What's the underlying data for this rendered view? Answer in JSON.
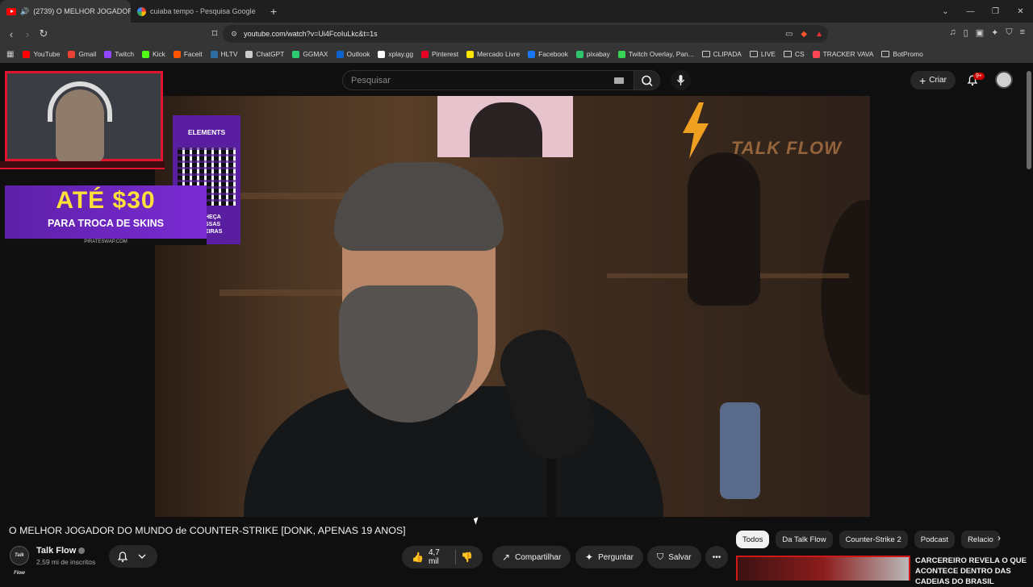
{
  "browser": {
    "tabs": [
      {
        "title": "(2739) O MELHOR JOGADOR",
        "active": true
      },
      {
        "title": "cuiaba tempo - Pesquisa Google",
        "active": false
      }
    ],
    "new_tab": "+",
    "url": "youtube.com/watch?v=Ui4FcoIuLkc&t=1s",
    "bookmarks": [
      {
        "label": "YouTube",
        "color": "#ff0000"
      },
      {
        "label": "Gmail",
        "color": "#ea4335"
      },
      {
        "label": "Twitch",
        "color": "#9146ff"
      },
      {
        "label": "Kick",
        "color": "#53fc18"
      },
      {
        "label": "Faceit",
        "color": "#ff5500"
      },
      {
        "label": "HLTV",
        "color": "#2d6da3"
      },
      {
        "label": "ChatGPT",
        "color": "#cccccc"
      },
      {
        "label": "GGMAX",
        "color": "#2ecc71"
      },
      {
        "label": "Outlook",
        "color": "#0a64d0"
      },
      {
        "label": "xplay.gg",
        "color": "#ffffff"
      },
      {
        "label": "Pinterest",
        "color": "#e60023"
      },
      {
        "label": "Mercado Livre",
        "color": "#ffe600"
      },
      {
        "label": "Facebook",
        "color": "#1877f2"
      },
      {
        "label": "pixabay",
        "color": "#2ec66d"
      },
      {
        "label": "Twitch Overlay, Pan...",
        "color": "#39d353"
      },
      {
        "label": "CLIPADA",
        "folder": true
      },
      {
        "label": "LIVE",
        "folder": true
      },
      {
        "label": "CS",
        "folder": true
      },
      {
        "label": "TRACKER VAVA",
        "color": "#ff4655"
      },
      {
        "label": "BotPromo",
        "folder": true
      }
    ]
  },
  "youtube": {
    "search_placeholder": "Pesquisar",
    "create_label": "Criar",
    "notifications_badge": "9+",
    "video_title": "O MELHOR JOGADOR DO MUNDO de COUNTER-STRIKE [DONK, APENAS 19 ANOS]",
    "channel": {
      "name": "Talk Flow",
      "subscribers": "2,59 mi de inscritos",
      "avatar_text": "Talk Flow"
    },
    "watermark": "TALK FLOW",
    "actions": {
      "likes": "4,7 mil",
      "share": "Compartilhar",
      "ask": "Perguntar",
      "save": "Salvar"
    },
    "chips": [
      "Todos",
      "Da Talk Flow",
      "Counter-Strike 2",
      "Podcast",
      "Relacio"
    ],
    "recommended_title": "CARCEREIRO REVELA O QUE ACONTECE DENTRO DAS CADEIAS DO BRASIL"
  },
  "overlay": {
    "promo_big": "ATÉ $30",
    "promo_sub": "PARA TROCA DE SKINS",
    "promo_foot": "PIRATESWAP.COM",
    "qr_title": "ELEMENTS",
    "qr_side": "HEÇA\nSSAS\nEIRAS"
  },
  "colors": {
    "yt_red": "#ff0000",
    "stream_red": "#e0142e",
    "promo_purple": "#7b2cd4",
    "promo_yellow": "#ffe03a"
  }
}
